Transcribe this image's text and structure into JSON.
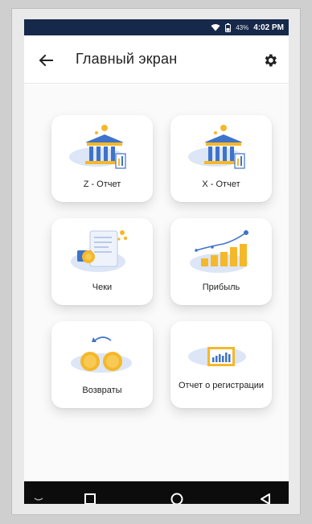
{
  "status_bar": {
    "battery_percent": "43%",
    "time": "4:02 PM"
  },
  "app_bar": {
    "title": "Главный экран"
  },
  "tiles": [
    {
      "label": "Z - Отчет"
    },
    {
      "label": "X - Отчет"
    },
    {
      "label": "Чеки"
    },
    {
      "label": "Прибыль"
    },
    {
      "label": "Возвраты"
    },
    {
      "label": "Отчет о регистрации"
    }
  ],
  "icons": {
    "status": [
      "wifi-icon",
      "battery-icon"
    ],
    "app_bar": [
      "back-arrow-icon",
      "gear-icon"
    ],
    "nav": [
      "back-nav-icon",
      "recent-apps-icon",
      "home-icon",
      "back-triangle-icon"
    ]
  },
  "colors": {
    "status_bar": "#16294a",
    "accent_yellow": "#f5b82a",
    "accent_blue": "#3f73c9",
    "nav_bar": "#0c0c0c"
  }
}
